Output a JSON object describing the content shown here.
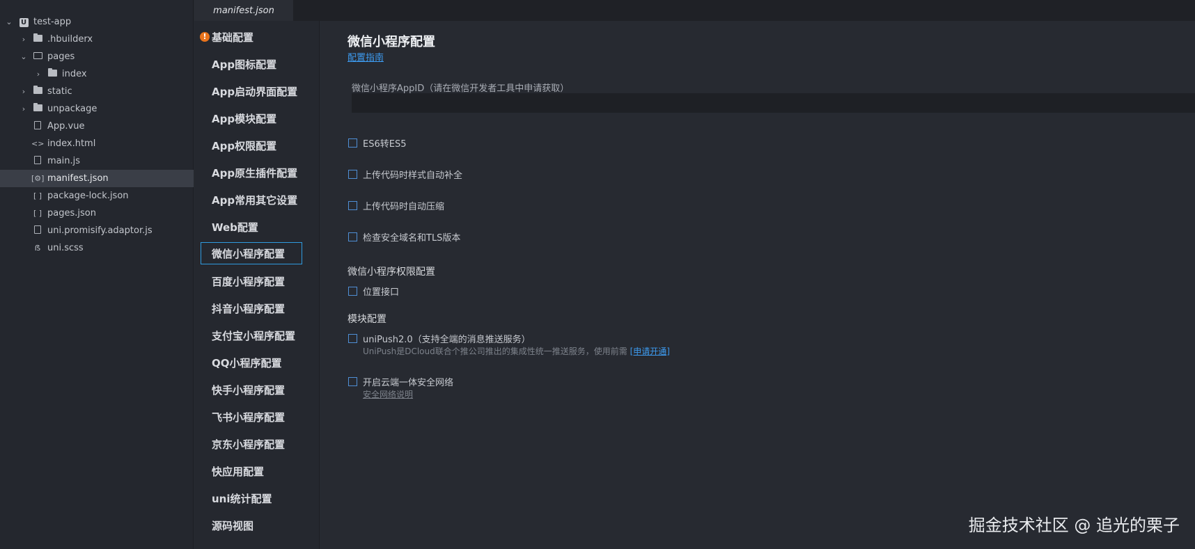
{
  "tabs": [
    {
      "label": "manifest.json"
    }
  ],
  "file_tree": {
    "project": "test-app",
    "items": [
      {
        "label": ".hbuilderx"
      },
      {
        "label": "pages"
      },
      {
        "label": "index"
      },
      {
        "label": "static"
      },
      {
        "label": "unpackage"
      },
      {
        "label": "App.vue"
      },
      {
        "label": "index.html"
      },
      {
        "label": "main.js"
      },
      {
        "label": "manifest.json"
      },
      {
        "label": "package-lock.json"
      },
      {
        "label": "pages.json"
      },
      {
        "label": "uni.promisify.adaptor.js"
      },
      {
        "label": "uni.scss"
      }
    ]
  },
  "settings_nav": [
    {
      "label": "基础配置"
    },
    {
      "label": "App图标配置"
    },
    {
      "label": "App启动界面配置"
    },
    {
      "label": "App模块配置"
    },
    {
      "label": "App权限配置"
    },
    {
      "label": "App原生插件配置"
    },
    {
      "label": "App常用其它设置"
    },
    {
      "label": "Web配置"
    },
    {
      "label": "微信小程序配置"
    },
    {
      "label": "百度小程序配置"
    },
    {
      "label": "抖音小程序配置"
    },
    {
      "label": "支付宝小程序配置"
    },
    {
      "label": "QQ小程序配置"
    },
    {
      "label": "快手小程序配置"
    },
    {
      "label": "飞书小程序配置"
    },
    {
      "label": "京东小程序配置"
    },
    {
      "label": "快应用配置"
    },
    {
      "label": "uni统计配置"
    },
    {
      "label": "源码视图"
    }
  ],
  "main": {
    "title": "微信小程序配置",
    "guide_link": "配置指南",
    "appid_label": "微信小程序AppID（请在微信开发者工具中申请获取）",
    "appid_value": "",
    "checkboxes": [
      {
        "label": "ES6转ES5",
        "checked": false
      },
      {
        "label": "上传代码时样式自动补全",
        "checked": false
      },
      {
        "label": "上传代码时自动压缩",
        "checked": false
      },
      {
        "label": "检查安全域名和TLS版本",
        "checked": false
      }
    ],
    "permission_section": {
      "title": "微信小程序权限配置",
      "location_label": "位置接口"
    },
    "module_section": {
      "title": "模块配置",
      "unipush_label": "uniPush2.0（支持全端的消息推送服务）",
      "unipush_desc": "UniPush是DCloud联合个推公司推出的集成性统一推送服务，使用前需",
      "unipush_link": "[申请开通]",
      "cloud_label": "开启云端一体安全网络",
      "cloud_link": "安全网络说明"
    }
  },
  "watermark": "掘金技术社区 @ 追光的栗子",
  "colors": {
    "accent": "#2f9be0",
    "warning": "#e8731c",
    "link": "#3d9bf0"
  }
}
